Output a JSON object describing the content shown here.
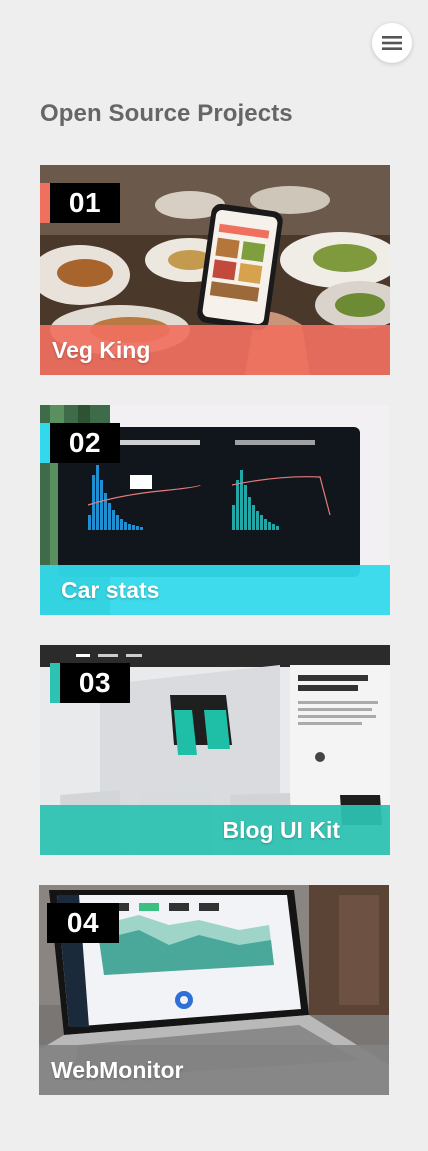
{
  "header": {
    "menu_icon": "hamburger-menu-icon",
    "title": "Open Source Projects"
  },
  "colors": {
    "background": "#eeeeee",
    "veg_king": "#f0705f",
    "car_stats": "#33d9ea",
    "blog_ui_kit": "#2ec2b3",
    "webmonitor": "#828282"
  },
  "projects": [
    {
      "number": "01",
      "name": "Veg King"
    },
    {
      "number": "02",
      "name": "Car stats"
    },
    {
      "number": "03",
      "name": "Blog UI Kit"
    },
    {
      "number": "04",
      "name": "WebMonitor"
    }
  ]
}
